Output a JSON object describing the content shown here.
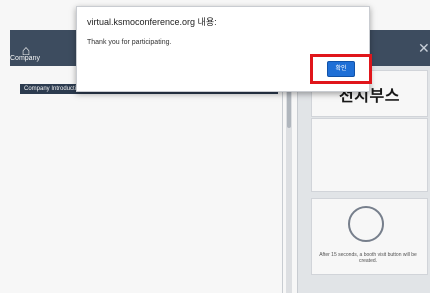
{
  "header": {
    "home_label": "Company",
    "home_icon": "home-icon",
    "close_icon": "close-icon"
  },
  "left": {
    "section_tab": "Company Introductio"
  },
  "right": {
    "booth_title": "전시부스",
    "timer_note": "After 15 seconds, a booth visit button will be created.",
    "timer_icon": "circle-icon"
  },
  "dialog": {
    "title": "virtual.ksmoconference.org 내용:",
    "message": "Thank you for participating.",
    "ok_label": "확인"
  },
  "colors": {
    "header": "#3f4f63",
    "accent": "#1f6fd6",
    "highlight": "#e0161b"
  }
}
